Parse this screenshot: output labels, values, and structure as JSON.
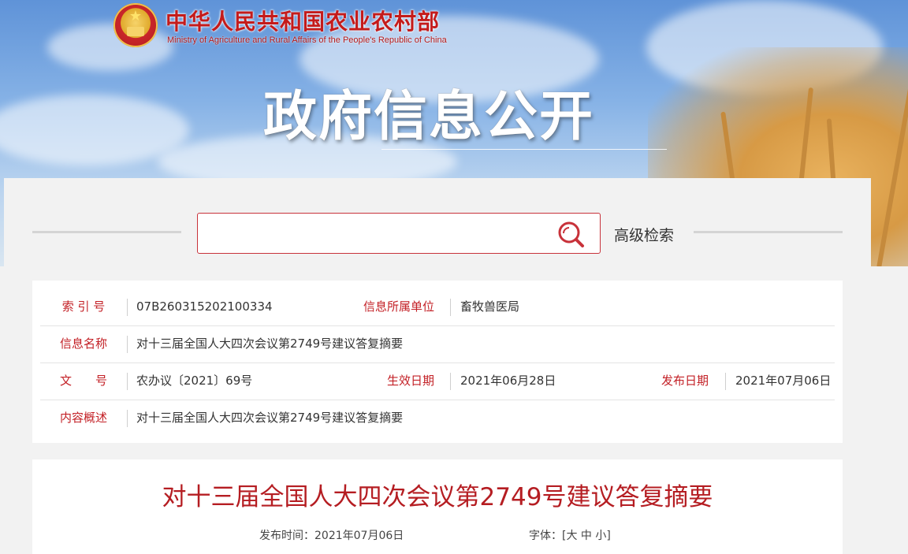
{
  "header": {
    "site_title": "中华人民共和国农业农村部",
    "site_subtitle": "Ministry of Agriculture and Rural Affairs of the People's Republic of China",
    "banner_title": "政府信息公开"
  },
  "search": {
    "placeholder": "",
    "value": "",
    "advanced_label": "高级检索"
  },
  "info": {
    "index_label": "索 引 号",
    "index_value": "07B260315202100334",
    "unit_label": "信息所属单位",
    "unit_value": "畜牧兽医局",
    "name_label": "信息名称",
    "name_value": "对十三届全国人大四次会议第2749号建议答复摘要",
    "doc_label": "文　　号",
    "doc_value": "农办议〔2021〕69号",
    "effective_label": "生效日期",
    "effective_value": "2021年06月28日",
    "publish_label": "发布日期",
    "publish_value": "2021年07月06日",
    "summary_label": "内容概述",
    "summary_value": "对十三届全国人大四次会议第2749号建议答复摘要"
  },
  "article": {
    "title": "对十三届全国人大四次会议第2749号建议答复摘要",
    "publish_time_label": "发布时间：",
    "publish_time_value": "2021年07月06日",
    "font_label": "字体：",
    "font_open": "[",
    "font_large": "大",
    "font_medium": "中",
    "font_small": "小",
    "font_close": "]"
  },
  "colors": {
    "accent_red": "#c32026",
    "title_red": "#b51d22",
    "search_border": "#c8323a"
  },
  "icons": {
    "emblem": "national-emblem-icon",
    "search": "search-icon"
  }
}
